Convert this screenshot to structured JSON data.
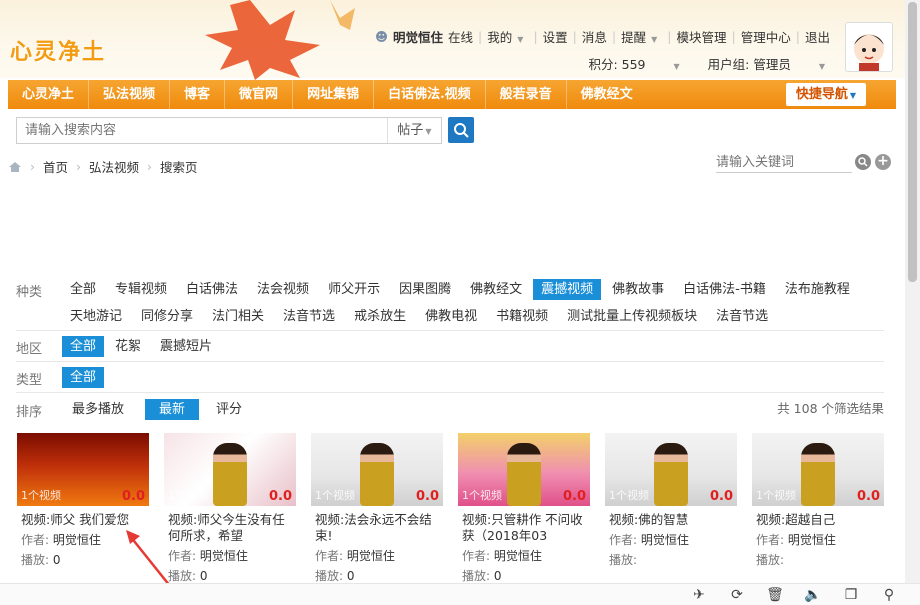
{
  "header": {
    "logo": "心灵净土",
    "user": {
      "name": "明觉恒住",
      "status": "在线",
      "my": "我的",
      "settings": "设置",
      "messages": "消息",
      "remind": "提醒",
      "module_admin": "模块管理",
      "admin_center": "管理中心",
      "logout": "退出",
      "points": "积分: 559",
      "group": "用户组: 管理员"
    }
  },
  "nav": {
    "items": [
      "心灵净土",
      "弘法视频",
      "博客",
      "微官网",
      "网址集锦",
      "白话佛法.视频",
      "般若录音",
      "佛教经文"
    ],
    "quick": "快捷导航"
  },
  "search": {
    "placeholder": "请输入搜索内容",
    "type": "帖子"
  },
  "breadcrumb": [
    "首页",
    "弘法视频",
    "搜索页"
  ],
  "keyword_search": {
    "placeholder": "请输入关键词"
  },
  "filters": {
    "kind_label": "种类",
    "kinds": [
      "全部",
      "专辑视频",
      "白话佛法",
      "法会视频",
      "师父开示",
      "因果图腾",
      "佛教经文",
      "震撼视频",
      "佛教故事",
      "白话佛法-书籍",
      "法布施教程",
      "天地游记",
      "同修分享",
      "法门相关",
      "法音节选",
      "戒杀放生",
      "佛教电视",
      "书籍视频",
      "测试批量上传视频板块",
      "法音节选"
    ],
    "kind_active": 7,
    "area_label": "地区",
    "areas": [
      "全部",
      "花絮",
      "震撼短片"
    ],
    "type_label": "类型",
    "types": [
      "全部"
    ],
    "sort_label": "排序",
    "sorts": [
      "最多播放",
      "最新",
      "评分"
    ],
    "sort_active": 1,
    "total": "共 108 个筛选结果"
  },
  "videos": [
    {
      "title": "视频:师父 我们爱您",
      "author_label": "作者:",
      "author": "明觉恒住",
      "plays_label": "播放:",
      "plays": "0",
      "count": "1个视频",
      "score": "0.0",
      "theme": "red"
    },
    {
      "title": "视频:师父今生没有任何所求，希望",
      "author_label": "作者:",
      "author": "明觉恒住",
      "plays_label": "播放:",
      "plays": "0",
      "count": "1个视频",
      "score": "0.0",
      "theme": "pink"
    },
    {
      "title": "视频:法会永远不会结束!",
      "author_label": "作者:",
      "author": "明觉恒住",
      "plays_label": "播放:",
      "plays": "0",
      "count": "1个视频",
      "score": "0.0",
      "theme": "stage"
    },
    {
      "title": "视频:只管耕作 不问收获（2018年03",
      "author_label": "作者:",
      "author": "明觉恒住",
      "plays_label": "播放:",
      "plays": "0",
      "count": "1个视频",
      "score": "0.0",
      "theme": "lotus"
    },
    {
      "title": "视频:佛的智慧",
      "author_label": "作者:",
      "author": "明觉恒住",
      "plays_label": "播放:",
      "plays": "",
      "count": "1个视频",
      "score": "0.0",
      "theme": "stage"
    },
    {
      "title": "视频:超越自己",
      "author_label": "作者:",
      "author": "明觉恒住",
      "plays_label": "播放:",
      "plays": "",
      "count": "1个视频",
      "score": "0.0",
      "theme": "stage"
    }
  ],
  "colors": {
    "accent": "#ef8a0c",
    "active": "#1a8fd8",
    "score": "#e02020",
    "link_blue": "#1e78c2"
  }
}
